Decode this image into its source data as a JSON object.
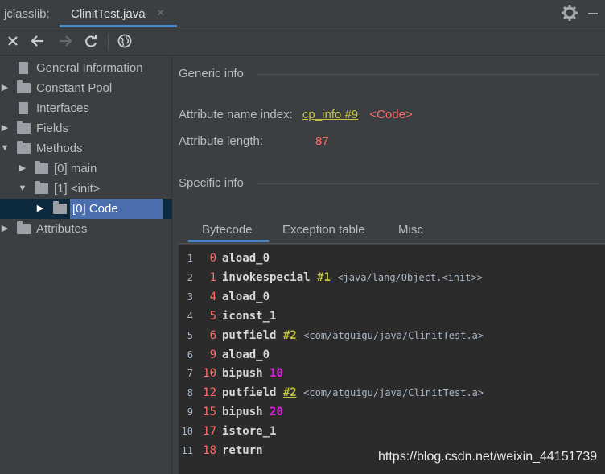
{
  "topbar": {
    "app_label": "jclasslib:",
    "tab_title": "ClinitTest.java",
    "tab_close": "×"
  },
  "toolbar": {
    "close": "close-icon",
    "back": "arrow-left-icon",
    "forward": "arrow-right-icon",
    "reload": "reload-icon",
    "browser": "globe-icon"
  },
  "tree": {
    "general": "General Information",
    "constant_pool": "Constant Pool",
    "interfaces": "Interfaces",
    "fields": "Fields",
    "methods": "Methods",
    "method_main": "[0] main",
    "method_init": "[1] <init>",
    "code": "[0] Code",
    "attributes": "Attributes"
  },
  "generic": {
    "title": "Generic info",
    "name_index_label": "Attribute name index:",
    "name_index_link": "cp_info #9",
    "name_index_value": "<Code>",
    "length_label": "Attribute length:",
    "length_value": "87"
  },
  "specific": {
    "title": "Specific info",
    "tabs": [
      "Bytecode",
      "Exception table",
      "Misc"
    ]
  },
  "bytecode": [
    {
      "line": "1",
      "offset": "0",
      "op": "aload_0",
      "ref": "",
      "comment": "",
      "num": ""
    },
    {
      "line": "2",
      "offset": "1",
      "op": "invokespecial",
      "ref": "#1",
      "comment": "<java/lang/Object.<init>>",
      "num": ""
    },
    {
      "line": "3",
      "offset": "4",
      "op": "aload_0",
      "ref": "",
      "comment": "",
      "num": ""
    },
    {
      "line": "4",
      "offset": "5",
      "op": "iconst_1",
      "ref": "",
      "comment": "",
      "num": ""
    },
    {
      "line": "5",
      "offset": "6",
      "op": "putfield",
      "ref": "#2",
      "comment": "<com/atguigu/java/ClinitTest.a>",
      "num": ""
    },
    {
      "line": "6",
      "offset": "9",
      "op": "aload_0",
      "ref": "",
      "comment": "",
      "num": ""
    },
    {
      "line": "7",
      "offset": "10",
      "op": "bipush",
      "ref": "",
      "comment": "",
      "num": "10"
    },
    {
      "line": "8",
      "offset": "12",
      "op": "putfield",
      "ref": "#2",
      "comment": "<com/atguigu/java/ClinitTest.a>",
      "num": ""
    },
    {
      "line": "9",
      "offset": "15",
      "op": "bipush",
      "ref": "",
      "comment": "",
      "num": "20"
    },
    {
      "line": "10",
      "offset": "17",
      "op": "istore_1",
      "ref": "",
      "comment": "",
      "num": ""
    },
    {
      "line": "11",
      "offset": "18",
      "op": "return",
      "ref": "",
      "comment": "",
      "num": ""
    }
  ],
  "watermark": "https://blog.csdn.net/weixin_44151739",
  "colors": {
    "accent": "#4a88c7",
    "selection": "#4b6eaf",
    "link": "#c3c33f",
    "value_red": "#ff6b68",
    "number_magenta": "#e020e0"
  }
}
